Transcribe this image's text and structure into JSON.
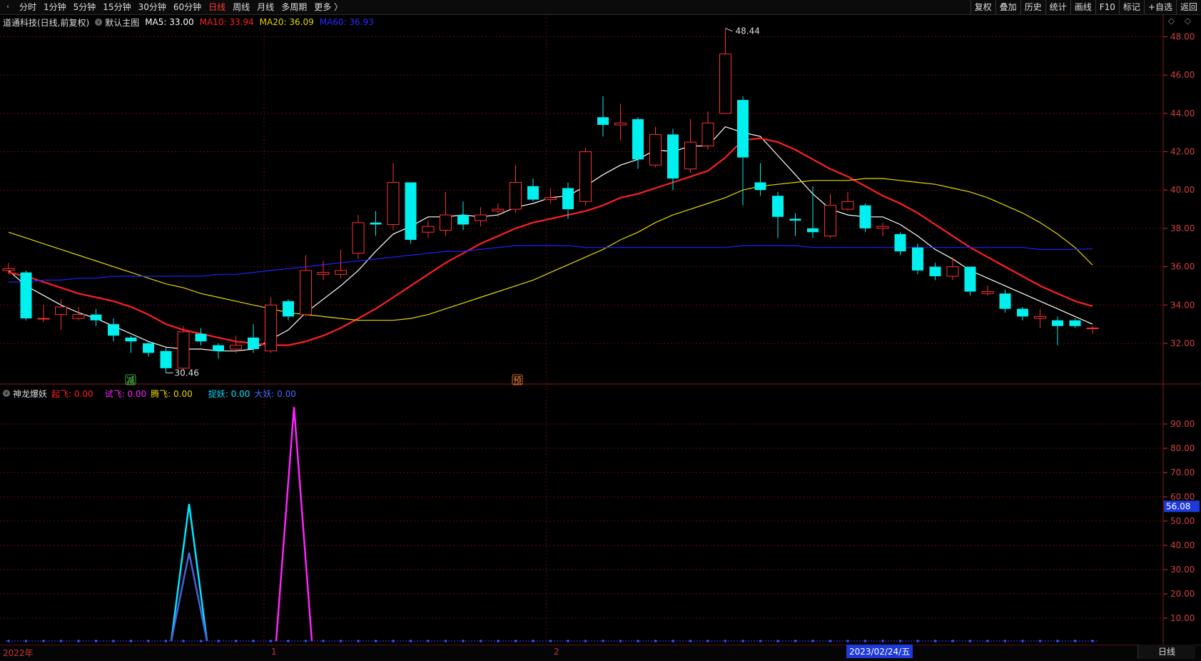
{
  "toolbar": {
    "left": [
      "分时",
      "1分钟",
      "5分钟",
      "15分钟",
      "30分钟",
      "60分钟",
      "日线",
      "周线",
      "月线",
      "多周期",
      "更多 〉"
    ],
    "active": "日线",
    "right": [
      "复权",
      "叠加",
      "历史",
      "统计",
      "画线",
      "F10",
      "标记",
      "+自选",
      "返回"
    ]
  },
  "main_header": {
    "stock": "道通科技(日线,前复权)",
    "indicator": "默认主图",
    "ma5": "MA5: 33.00",
    "ma10": "MA10: 33.94",
    "ma20": "MA20: 36.09",
    "ma60": "MA60: 36.93",
    "colors": {
      "ma5": "#ffffff",
      "ma10": "#ff2020",
      "ma20": "#e8d800",
      "ma60": "#2020ff"
    }
  },
  "sub_header": {
    "name": "神龙爆妖",
    "qifei": "起飞: 0.00",
    "shifei": "试飞: 0.00",
    "tengfei": "腾飞: 0.00",
    "zhuoyao": "捉妖: 0.00",
    "dayao": "大妖: 0.00"
  },
  "top_right_icons": [
    "◇",
    "◇"
  ],
  "y_axis_main": [
    "48.00",
    "46.00",
    "44.00",
    "42.00",
    "40.00",
    "38.00",
    "36.00",
    "34.00",
    "32.00"
  ],
  "y_axis_sub": [
    "90.00",
    "80.00",
    "70.00",
    "60.00",
    "50.00",
    "40.00",
    "30.00",
    "20.00",
    "10.00"
  ],
  "sub_marker": "56.08",
  "annotations": {
    "high": "48.44",
    "low": "30.46",
    "sig1": "减",
    "sig2": "预"
  },
  "x_axis": {
    "start": "2022年",
    "m1": "1",
    "m2": "2"
  },
  "date_box": "2023/02/24/五",
  "period_button": "日线",
  "chart_data": {
    "type": "candlestick",
    "title": "道通科技(日线,前复权)",
    "ylim": [
      29.8,
      48.8
    ],
    "candles": [
      [
        35.8,
        35.9,
        36.2,
        35.6
      ],
      [
        35.7,
        33.3,
        35.8,
        33.2
      ],
      [
        33.3,
        33.3,
        34.0,
        33.1
      ],
      [
        33.5,
        33.9,
        34.3,
        32.7
      ],
      [
        33.3,
        33.5,
        33.9,
        33.2
      ],
      [
        33.5,
        33.2,
        33.8,
        32.9
      ],
      [
        33.0,
        32.4,
        33.3,
        32.1
      ],
      [
        32.3,
        32.1,
        32.4,
        31.5
      ],
      [
        32.0,
        31.5,
        32.1,
        31.3
      ],
      [
        31.6,
        30.7,
        31.8,
        30.46
      ],
      [
        30.7,
        32.6,
        32.9,
        30.6
      ],
      [
        32.5,
        32.1,
        32.8,
        31.9
      ],
      [
        31.9,
        31.6,
        32.0,
        31.2
      ],
      [
        31.7,
        31.9,
        32.4,
        31.5
      ],
      [
        32.3,
        31.7,
        33.0,
        31.5
      ],
      [
        31.6,
        34.0,
        34.4,
        31.5
      ],
      [
        34.2,
        33.4,
        34.3,
        33.2
      ],
      [
        33.5,
        35.8,
        36.6,
        33.4
      ],
      [
        35.6,
        35.7,
        36.3,
        35.3
      ],
      [
        35.6,
        35.8,
        36.9,
        35.4
      ],
      [
        36.7,
        38.3,
        38.7,
        36.4
      ],
      [
        38.3,
        38.2,
        38.9,
        37.6
      ],
      [
        38.2,
        40.4,
        41.4,
        37.9
      ],
      [
        40.4,
        37.4,
        40.4,
        37.2
      ],
      [
        37.8,
        38.1,
        38.4,
        37.5
      ],
      [
        37.9,
        38.7,
        39.9,
        37.6
      ],
      [
        38.7,
        38.2,
        39.4,
        37.9
      ],
      [
        38.4,
        38.7,
        39.1,
        38.1
      ],
      [
        38.9,
        39.0,
        39.3,
        38.6
      ],
      [
        39.0,
        40.4,
        41.3,
        38.8
      ],
      [
        40.2,
        39.5,
        40.6,
        39.4
      ],
      [
        39.5,
        39.6,
        40.1,
        39.3
      ],
      [
        40.1,
        39.0,
        40.4,
        38.5
      ],
      [
        39.4,
        42.0,
        42.2,
        39.2
      ],
      [
        43.8,
        43.4,
        44.9,
        42.8
      ],
      [
        43.4,
        43.5,
        44.5,
        42.6
      ],
      [
        43.7,
        41.6,
        43.8,
        41.1
      ],
      [
        41.3,
        42.9,
        43.3,
        41.2
      ],
      [
        42.9,
        40.6,
        43.2,
        40.0
      ],
      [
        41.1,
        42.5,
        43.7,
        40.9
      ],
      [
        42.3,
        43.5,
        44.1,
        42.1
      ],
      [
        44.0,
        47.1,
        48.44,
        44.0
      ],
      [
        44.7,
        41.7,
        44.9,
        39.2
      ],
      [
        40.4,
        40.0,
        41.4,
        39.7
      ],
      [
        39.7,
        38.6,
        39.9,
        37.5
      ],
      [
        38.5,
        38.4,
        38.8,
        37.6
      ],
      [
        38.0,
        37.8,
        40.2,
        37.5
      ],
      [
        37.6,
        39.2,
        39.8,
        37.5
      ],
      [
        39.0,
        39.4,
        39.9,
        38.9
      ],
      [
        39.2,
        38.0,
        39.3,
        37.8
      ],
      [
        38.0,
        38.1,
        38.3,
        37.6
      ],
      [
        37.7,
        36.8,
        37.8,
        36.6
      ],
      [
        37.0,
        35.8,
        37.2,
        35.6
      ],
      [
        36.0,
        35.5,
        36.2,
        35.3
      ],
      [
        35.5,
        36.0,
        36.5,
        35.3
      ],
      [
        36.0,
        34.7,
        36.0,
        34.5
      ],
      [
        34.6,
        34.7,
        35.0,
        34.5
      ],
      [
        34.6,
        33.8,
        34.8,
        33.6
      ],
      [
        33.8,
        33.4,
        33.9,
        33.2
      ],
      [
        33.3,
        33.4,
        33.8,
        32.8
      ],
      [
        33.2,
        32.9,
        33.4,
        31.9
      ],
      [
        33.2,
        32.9,
        33.3,
        32.8
      ],
      [
        32.8,
        32.8,
        32.9,
        32.5
      ]
    ],
    "series": [
      {
        "name": "MA5",
        "values": [
          35.8,
          35.0,
          34.5,
          34.0,
          33.6,
          33.3,
          32.9,
          32.5,
          32.1,
          31.8,
          31.7,
          31.7,
          31.6,
          31.6,
          31.7,
          32.2,
          32.7,
          33.6,
          34.3,
          35.0,
          35.8,
          36.8,
          37.7,
          38.1,
          38.6,
          38.6,
          38.7,
          38.6,
          38.7,
          39.1,
          39.3,
          39.6,
          39.7,
          40.2,
          40.8,
          41.3,
          41.6,
          42.1,
          42.0,
          42.3,
          42.3,
          43.3,
          43.0,
          42.8,
          41.8,
          40.8,
          39.8,
          39.0,
          38.7,
          38.6,
          38.6,
          38.2,
          37.6,
          36.9,
          36.4,
          35.8,
          35.4,
          35.0,
          34.6,
          34.2,
          33.8,
          33.4,
          33.0
        ]
      },
      {
        "name": "MA10",
        "values": [
          35.7,
          35.5,
          35.2,
          34.9,
          34.6,
          34.4,
          34.2,
          33.9,
          33.5,
          33.0,
          32.7,
          32.5,
          32.3,
          32.1,
          32.0,
          31.9,
          31.9,
          32.1,
          32.4,
          32.8,
          33.3,
          33.8,
          34.4,
          35.0,
          35.6,
          36.2,
          36.7,
          37.2,
          37.6,
          38.0,
          38.3,
          38.5,
          38.7,
          38.9,
          39.2,
          39.6,
          39.8,
          40.1,
          40.4,
          40.7,
          41.0,
          41.7,
          42.6,
          42.7,
          42.5,
          42.1,
          41.6,
          41.1,
          40.7,
          40.2,
          39.7,
          39.3,
          38.8,
          38.2,
          37.6,
          37.0,
          36.5,
          36.0,
          35.5,
          35.0,
          34.6,
          34.2,
          33.94
        ]
      },
      {
        "name": "MA20",
        "values": [
          37.8,
          37.5,
          37.2,
          36.9,
          36.6,
          36.3,
          36.0,
          35.7,
          35.4,
          35.1,
          34.9,
          34.6,
          34.4,
          34.2,
          34.0,
          33.8,
          33.6,
          33.5,
          33.4,
          33.3,
          33.2,
          33.2,
          33.2,
          33.3,
          33.5,
          33.8,
          34.1,
          34.4,
          34.7,
          35.0,
          35.3,
          35.7,
          36.1,
          36.5,
          36.9,
          37.4,
          37.8,
          38.3,
          38.7,
          39.0,
          39.3,
          39.6,
          40.0,
          40.2,
          40.3,
          40.4,
          40.5,
          40.5,
          40.5,
          40.6,
          40.6,
          40.5,
          40.4,
          40.3,
          40.1,
          39.9,
          39.6,
          39.2,
          38.8,
          38.3,
          37.7,
          37.0,
          36.09
        ]
      },
      {
        "name": "MA60",
        "values": [
          35.2,
          35.2,
          35.3,
          35.3,
          35.4,
          35.4,
          35.5,
          35.5,
          35.5,
          35.5,
          35.5,
          35.5,
          35.6,
          35.6,
          35.7,
          35.8,
          35.9,
          36.0,
          36.1,
          36.2,
          36.3,
          36.4,
          36.5,
          36.6,
          36.7,
          36.8,
          36.8,
          36.9,
          37.0,
          37.1,
          37.1,
          37.1,
          37.1,
          37.0,
          37.0,
          37.0,
          37.0,
          37.0,
          37.0,
          37.0,
          37.0,
          37.0,
          37.1,
          37.1,
          37.1,
          37.1,
          37.0,
          37.0,
          37.0,
          37.0,
          37.0,
          37.0,
          37.0,
          37.0,
          37.0,
          37.0,
          37.0,
          37.0,
          37.0,
          36.9,
          36.9,
          36.9,
          36.93
        ]
      }
    ],
    "sub_chart": {
      "ylim": [
        0,
        100
      ],
      "spikes": [
        {
          "index": 10,
          "value": 57,
          "color": "#00e5ff"
        },
        {
          "index": 10,
          "value": 37,
          "color": "#4a5fd8"
        },
        {
          "index": 16,
          "value": 97,
          "color": "#ff22ff"
        }
      ]
    }
  }
}
